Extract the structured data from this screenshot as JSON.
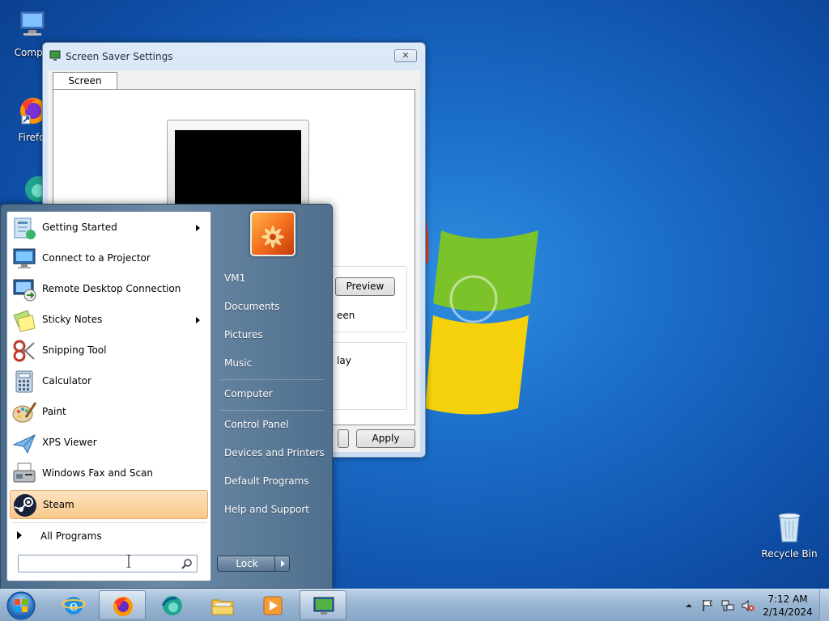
{
  "desktop": {
    "icons": [
      {
        "label": "Compu",
        "name": "computer"
      },
      {
        "label": "Firefo",
        "name": "firefox"
      },
      {
        "label": "Recycle Bin",
        "name": "recycle-bin"
      }
    ]
  },
  "screensaver_window": {
    "title": "Screen Saver Settings",
    "close_label": "✕",
    "tab_label": "Screen Saver",
    "preview_label": "Preview",
    "apply_label": "Apply",
    "partial_text_1": "een",
    "partial_text_2": "lay"
  },
  "start_menu": {
    "programs": [
      {
        "label": "Getting Started",
        "icon": "getting-started-icon",
        "submenu": true
      },
      {
        "label": "Connect to a Projector",
        "icon": "projector-icon",
        "submenu": false
      },
      {
        "label": "Remote Desktop Connection",
        "icon": "remote-desktop-icon",
        "submenu": false
      },
      {
        "label": "Sticky Notes",
        "icon": "sticky-notes-icon",
        "submenu": true
      },
      {
        "label": "Snipping Tool",
        "icon": "scissors-icon",
        "submenu": false
      },
      {
        "label": "Calculator",
        "icon": "calculator-icon",
        "submenu": false
      },
      {
        "label": "Paint",
        "icon": "paint-palette-icon",
        "submenu": false
      },
      {
        "label": "XPS Viewer",
        "icon": "xps-viewer-icon",
        "submenu": false
      },
      {
        "label": "Windows Fax and Scan",
        "icon": "fax-icon",
        "submenu": false
      },
      {
        "label": "Steam",
        "icon": "steam-icon",
        "submenu": false
      }
    ],
    "all_programs_label": "All Programs",
    "search": {
      "value": "",
      "placeholder": ""
    },
    "right_items": [
      {
        "label": "VM1"
      },
      {
        "label": "Documents"
      },
      {
        "label": "Pictures"
      },
      {
        "label": "Music"
      },
      {
        "label": "Computer"
      },
      {
        "label": "Control Panel"
      },
      {
        "label": "Devices and Printers"
      },
      {
        "label": "Default Programs"
      },
      {
        "label": "Help and Support"
      }
    ],
    "lock_label": "Lock"
  },
  "taskbar": {
    "apps": [
      "internet-explorer",
      "firefox",
      "edge",
      "file-explorer",
      "media-player",
      "screen-saver-settings"
    ],
    "clock": {
      "time": "7:12 AM",
      "date": "2/14/2024"
    }
  },
  "colors": {
    "highlight": "#f9c88a",
    "desktop_blue": "#1a6cc8"
  }
}
